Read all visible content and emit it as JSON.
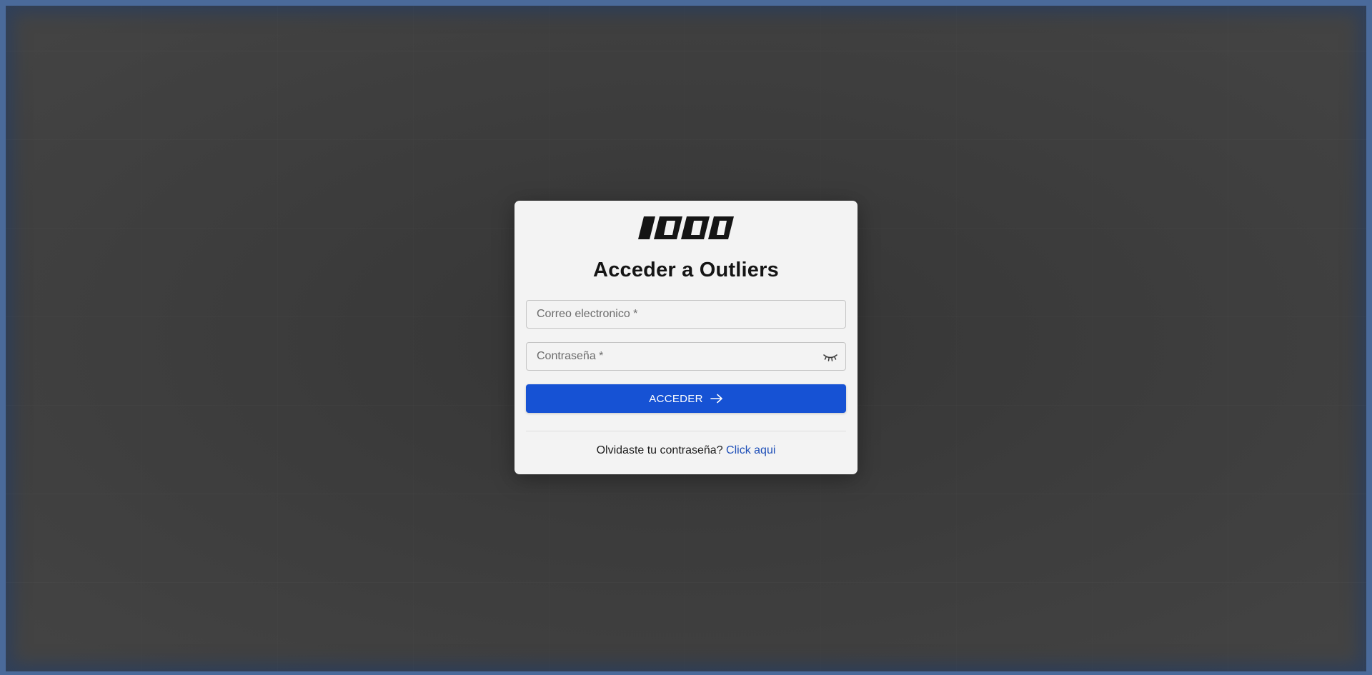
{
  "login": {
    "logo_icon": "brand-stripes-logo",
    "title": "Acceder a Outliers",
    "email": {
      "value": "",
      "placeholder": "Correo electronico *"
    },
    "password": {
      "value": "",
      "placeholder": "Contraseña *",
      "toggle_icon": "eye-closed-icon"
    },
    "submit_label": "ACCEDER",
    "submit_icon": "arrow-right-icon",
    "forgot_text": "Olvidaste tu contraseña?",
    "forgot_link": "Click aqui"
  },
  "colors": {
    "primary": "#1652d4",
    "link": "#1e4fb8",
    "card_background": "#f3f3f3",
    "page_background": "#3c3c3c",
    "title_text": "#151515"
  }
}
